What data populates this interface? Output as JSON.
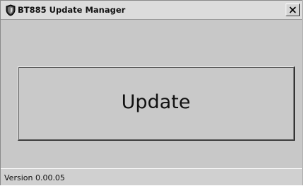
{
  "window": {
    "title": "BT885 Update Manager",
    "icon": "shield-icon",
    "close_icon": "close-icon"
  },
  "main": {
    "update_button_label": "Update"
  },
  "statusbar": {
    "version": "Version 0.00.05"
  },
  "colors": {
    "window_background": "#c8c8c8",
    "titlebar_background": "#dcdcdc",
    "text": "#111111"
  }
}
